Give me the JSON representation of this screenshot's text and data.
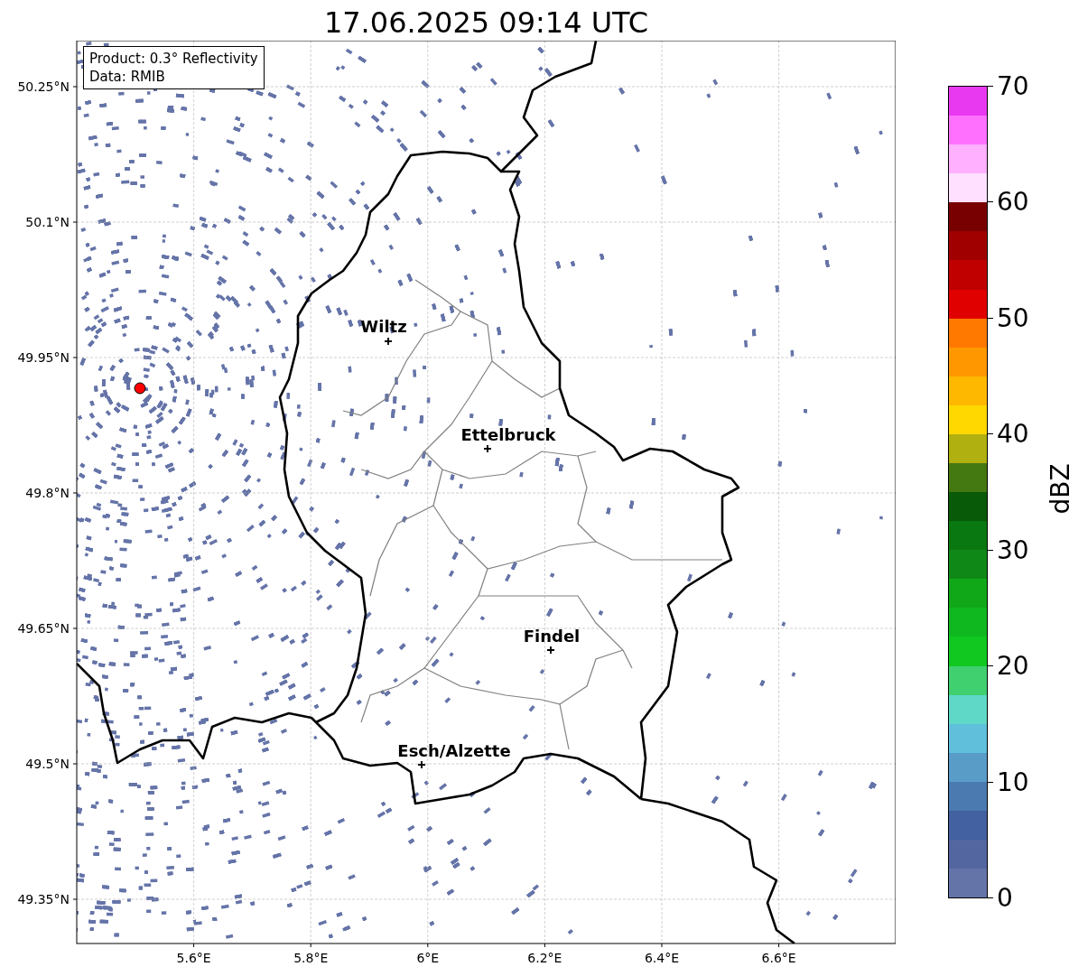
{
  "title": "17.06.2025 09:14 UTC",
  "info_box": [
    "Product: 0.3° Reflectivity",
    "Data: RMIB"
  ],
  "map": {
    "lat_ticks": [
      "50.25°N",
      "50.1°N",
      "49.95°N",
      "49.8°N",
      "49.65°N",
      "49.5°N",
      "49.35°N"
    ],
    "lon_ticks": [
      "5.6°E",
      "5.8°E",
      "6°E",
      "6.2°E",
      "6.4°E",
      "6.6°E"
    ],
    "cities": [
      {
        "name": "Wiltz"
      },
      {
        "name": "Ettelbruck"
      },
      {
        "name": "Findel"
      },
      {
        "name": "Esch/Alzette"
      }
    ],
    "radar_site": {
      "color": "#ff0000"
    }
  },
  "colorbar": {
    "label": "dBZ",
    "ticks": [
      "70",
      "60",
      "50",
      "40",
      "30",
      "20",
      "10",
      "0"
    ],
    "bins": [
      {
        "color": "#e838f0"
      },
      {
        "color": "#ff70ff"
      },
      {
        "color": "#ffb0ff"
      },
      {
        "color": "#ffe0ff"
      },
      {
        "color": "#780000"
      },
      {
        "color": "#a00000"
      },
      {
        "color": "#c00000"
      },
      {
        "color": "#e00000"
      },
      {
        "color": "#ff7800"
      },
      {
        "color": "#ff9800"
      },
      {
        "color": "#ffb800"
      },
      {
        "color": "#ffd800"
      },
      {
        "color": "#b0b010"
      },
      {
        "color": "#447810"
      },
      {
        "color": "#085a08"
      },
      {
        "color": "#0a7810"
      },
      {
        "color": "#108818"
      },
      {
        "color": "#10a818"
      },
      {
        "color": "#10b820"
      },
      {
        "color": "#10c820"
      },
      {
        "color": "#40d070"
      },
      {
        "color": "#60d8c8"
      },
      {
        "color": "#60c0dc"
      },
      {
        "color": "#5a9cc8"
      },
      {
        "color": "#4a7ab0"
      },
      {
        "color": "#4360a0"
      },
      {
        "color": "#5466a0"
      },
      {
        "color": "#6574a8"
      }
    ]
  }
}
